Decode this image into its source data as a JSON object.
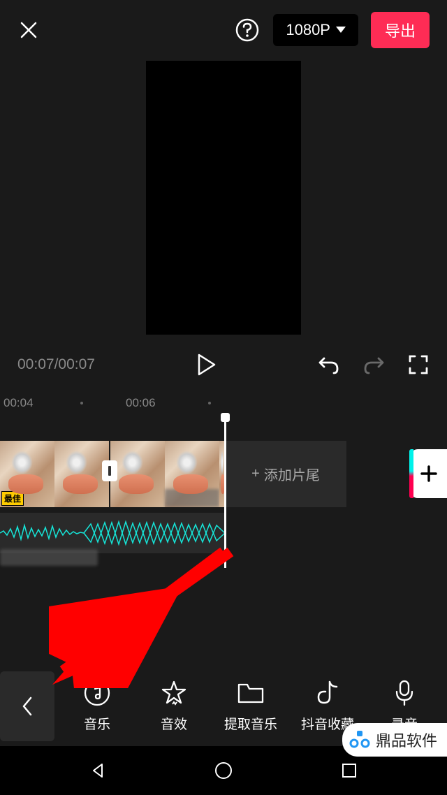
{
  "header": {
    "resolution_label": "1080P",
    "export_label": "导出"
  },
  "transport": {
    "current_time": "00:07",
    "total_time": "00:07"
  },
  "ruler": {
    "t1": "00:04",
    "t2": "00:06"
  },
  "timeline": {
    "add_end_label": "添加片尾",
    "clip_badge": "最佳"
  },
  "tools": {
    "music": "音乐",
    "sfx": "音效",
    "extract": "提取音乐",
    "douyin": "抖音收藏",
    "record": "录音"
  },
  "watermark": {
    "text": "鼎品软件"
  }
}
